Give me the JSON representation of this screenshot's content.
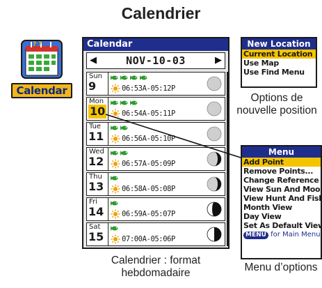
{
  "page_title": "Calendrier",
  "app_icon": {
    "label": "Calendar",
    "icon": "calendar-icon"
  },
  "calendar": {
    "title": "Calendar",
    "date": "NOV-10-03",
    "prev_icon": "triangle-left-icon",
    "next_icon": "triangle-right-icon",
    "days": [
      {
        "name": "Sun",
        "num": "9",
        "times": "06:53A-05:12P",
        "fish": 4,
        "moon": "full"
      },
      {
        "name": "Mon",
        "num": "10",
        "times": "06:54A-05:11P",
        "fish": 3,
        "moon": "full",
        "selected": true
      },
      {
        "name": "Tue",
        "num": "11",
        "times": "06:56A-05:10P",
        "fish": 2,
        "moon": "full"
      },
      {
        "name": "Wed",
        "num": "12",
        "times": "06:57A-05:09P",
        "fish": 2,
        "moon": "gibbous"
      },
      {
        "name": "Thu",
        "num": "13",
        "times": "06:58A-05:08P",
        "fish": 1,
        "moon": "gibbous"
      },
      {
        "name": "Fri",
        "num": "14",
        "times": "06:59A-05:07P",
        "fish": 1,
        "moon": "waning-gibbous"
      },
      {
        "name": "Sat",
        "num": "15",
        "times": "07:00A-05:06P",
        "fish": 1,
        "moon": "half"
      }
    ]
  },
  "new_location_menu": {
    "title": "New Location",
    "items": [
      "Current Location",
      "Use Map",
      "Use Find Menu"
    ]
  },
  "options_menu": {
    "title": "Menu",
    "items": [
      "Add Point",
      "Remove Points...",
      "Change Reference",
      "View Sun And Moon",
      "View Hunt And Fish",
      "Month View",
      "Day View",
      "Set As Default View"
    ],
    "footer_key": "MENU",
    "footer_text": "for Main Menu"
  },
  "captions": {
    "new_location": "Options de nouvelle position",
    "calendar": "Calendrier : format hebdomadaire",
    "options": "Menu d’options"
  },
  "colors": {
    "title_bar": "#1f2e8c",
    "highlight": "#f5c400",
    "fish": "#2e9a2e",
    "sun": "#f0a000"
  }
}
